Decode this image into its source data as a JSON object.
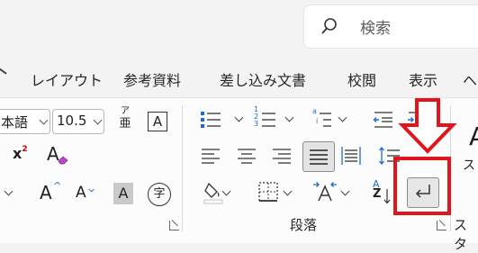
{
  "search": {
    "placeholder": "検索"
  },
  "tabs": [
    "レイアウト",
    "参考資料",
    "差し込み文書",
    "校閲",
    "表示",
    "ヘ"
  ],
  "font": {
    "name_value": "本語",
    "size_value": "10.5",
    "phonetic_top": "ア",
    "phonetic_bottom": "亜",
    "box_char": "A",
    "superscript_x": "x",
    "superscript_2": "2",
    "clear_A": "A",
    "grow_A": "A",
    "shrink_A": "A",
    "shade_A": "A",
    "enclose_char": "字"
  },
  "paragraph": {
    "group_label": "段落",
    "numbering_digits": [
      "1",
      "2",
      "3"
    ],
    "multilevel_letters": [
      "a",
      "i"
    ],
    "sort_top": "A",
    "sort_bottom": "Z"
  },
  "styles": {
    "group_label_fragment": "スタ",
    "side_char": "ス",
    "big_char": "A"
  },
  "colors": {
    "annotation": "#e0161c",
    "ribbon_bg": "#fcfcfc",
    "accent_blue": "#1e6bc7"
  }
}
